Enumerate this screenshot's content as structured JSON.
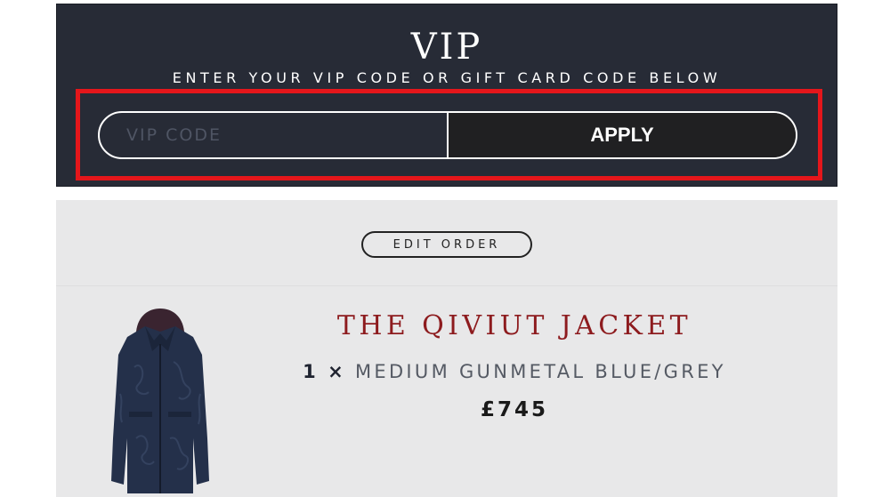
{
  "vip": {
    "title": "VIP",
    "subtitle": "ENTER YOUR VIP CODE OR GIFT CARD CODE BELOW",
    "input_placeholder": "VIP CODE",
    "input_value": "",
    "apply_label": "APPLY"
  },
  "order": {
    "edit_label": "EDIT ORDER",
    "items": [
      {
        "image_icon": "jacket-product-image",
        "name": "THE QIVIUT JACKET",
        "quantity": "1",
        "separator": "×",
        "variant": "MEDIUM GUNMETAL BLUE/GREY",
        "price": "£745"
      }
    ]
  },
  "colors": {
    "panel_dark": "#272b36",
    "highlight": "#e4161b",
    "apply_bg": "#202022",
    "product_name": "#8d1b1e",
    "order_bg": "#e8e8e9"
  }
}
